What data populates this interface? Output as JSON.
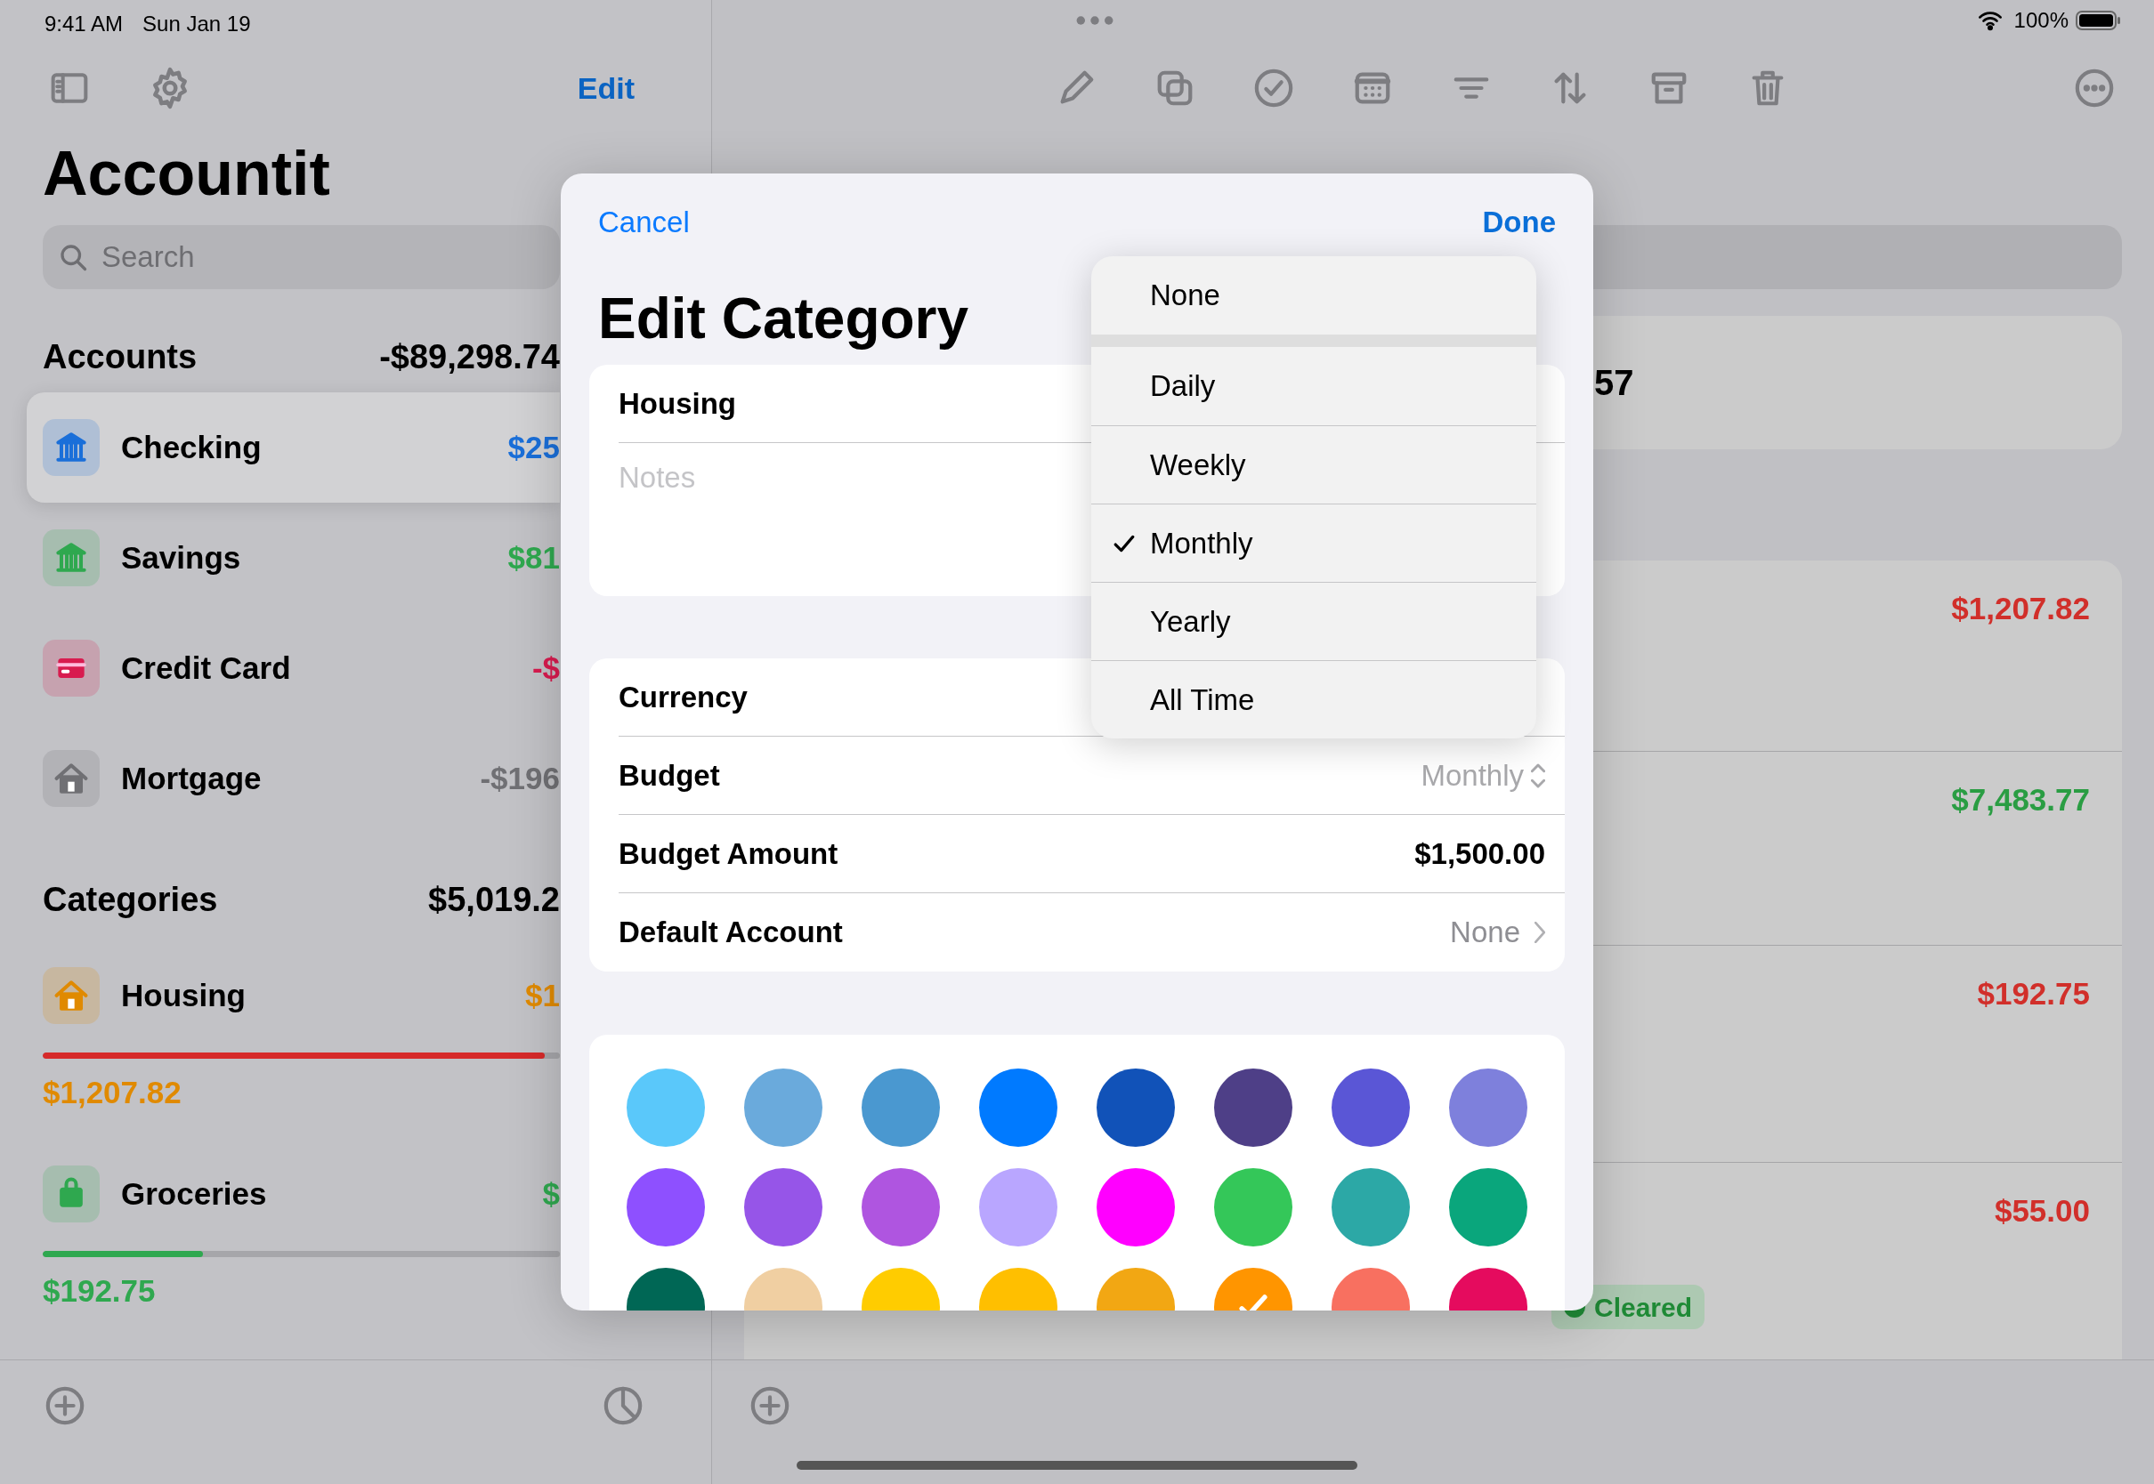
{
  "status_bar": {
    "time": "9:41 AM",
    "date": "Sun Jan 19",
    "battery": "100%"
  },
  "sidebar": {
    "edit": "Edit",
    "title": "Accountit",
    "search": {
      "placeholder": "Search"
    },
    "accounts_header": {
      "label": "Accounts",
      "total": "-$89,298.74"
    },
    "accounts": [
      {
        "name": "Checking",
        "amount": "$25",
        "kind": "bank",
        "color": "#1a6fd9",
        "selected": true
      },
      {
        "name": "Savings",
        "amount": "$81",
        "kind": "bank",
        "color": "#2fa84f",
        "selected": false
      },
      {
        "name": "Credit Card",
        "amount": "-$",
        "kind": "card",
        "color": "#d81b4f",
        "selected": false
      },
      {
        "name": "Mortgage",
        "amount": "-$196",
        "kind": "house",
        "color": "#707074",
        "selected": false
      }
    ],
    "categories_header": {
      "label": "Categories",
      "total": "$5,019.2"
    },
    "categories": [
      {
        "name": "Housing",
        "amount": "$1",
        "spent": "$1,207.82",
        "kind": "house",
        "color": "#e08a00",
        "progress": {
          "level": 0.97,
          "color": "#d62a2a"
        }
      },
      {
        "name": "Groceries",
        "amount": "$",
        "spent": "$192.75",
        "kind": "bag",
        "color": "#2fa84f",
        "progress": {
          "level": 0.31,
          "color": "#2fa84f"
        }
      }
    ]
  },
  "detail": {
    "balance": "57",
    "transactions": [
      {
        "amount": "$1,207.82",
        "color": "#d12f2a"
      },
      {
        "amount": "$7,483.77",
        "color": "#2a9d43"
      },
      {
        "amount": "$192.75",
        "color": "#d12f2a"
      },
      {
        "amount": "$55.00",
        "color": "#d12f2a",
        "status": "Cleared"
      }
    ]
  },
  "modal": {
    "cancel": "Cancel",
    "done": "Done",
    "title": "Edit Category",
    "name": "Housing",
    "notes": {
      "placeholder": "Notes"
    },
    "rows": [
      {
        "label": "Currency",
        "kind": "plain"
      },
      {
        "label": "Budget",
        "value": "Monthly",
        "kind": "popup"
      },
      {
        "label": "Budget Amount",
        "value": "$1,500.00",
        "kind": "amount"
      },
      {
        "label": "Default Account",
        "value": "None",
        "kind": "link"
      }
    ],
    "colors": [
      {
        "color": "#5ac8fa",
        "selected": false
      },
      {
        "color": "#6aaadc",
        "selected": false
      },
      {
        "color": "#4a98d0",
        "selected": false
      },
      {
        "color": "#007aff",
        "selected": false
      },
      {
        "color": "#1152b8",
        "selected": false
      },
      {
        "color": "#4e3f87",
        "selected": false
      },
      {
        "color": "#5a56d6",
        "selected": false
      },
      {
        "color": "#7e80dc",
        "selected": false
      },
      {
        "color": "#8e50ff",
        "selected": false
      },
      {
        "color": "#9655e8",
        "selected": false
      },
      {
        "color": "#af55e0",
        "selected": false
      },
      {
        "color": "#b9a6ff",
        "selected": false
      },
      {
        "color": "#ff00ff",
        "selected": false
      },
      {
        "color": "#34c759",
        "selected": false
      },
      {
        "color": "#2ca8a6",
        "selected": false
      },
      {
        "color": "#0aa67c",
        "selected": false
      },
      {
        "color": "#006755",
        "selected": false
      },
      {
        "color": "#f0cfa2",
        "selected": false
      },
      {
        "color": "#ffcc00",
        "selected": false
      },
      {
        "color": "#ffbf00",
        "selected": false
      },
      {
        "color": "#f2a713",
        "selected": false
      },
      {
        "color": "#ff9500",
        "selected": true
      },
      {
        "color": "#f87060",
        "selected": false
      },
      {
        "color": "#e50b5e",
        "selected": false
      }
    ],
    "menu": [
      {
        "label": "None",
        "selected": false
      },
      {
        "label": "Daily",
        "selected": false
      },
      {
        "label": "Weekly",
        "selected": false
      },
      {
        "label": "Monthly",
        "selected": true
      },
      {
        "label": "Yearly",
        "selected": false
      },
      {
        "label": "All Time",
        "selected": false
      }
    ]
  }
}
